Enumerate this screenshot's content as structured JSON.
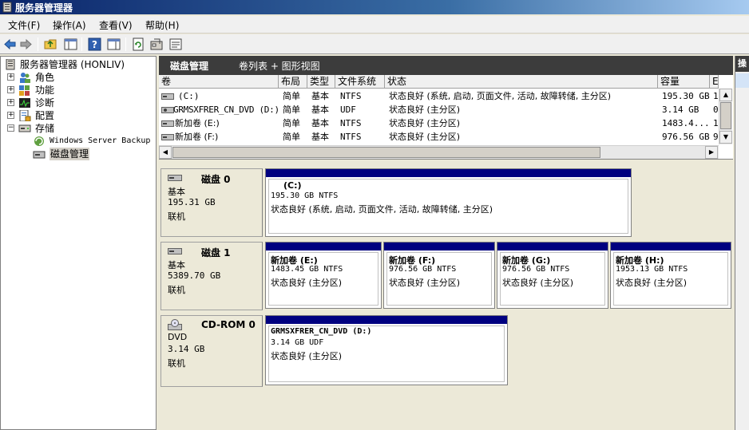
{
  "window": {
    "title": "服务器管理器"
  },
  "menu": [
    "文件(F)",
    "操作(A)",
    "查看(V)",
    "帮助(H)"
  ],
  "toolbar": {
    "icons": [
      "back-arrow-icon",
      "forward-arrow-icon",
      "up-folder-icon",
      "show-hide-tree-icon",
      "help-icon",
      "show-hide-action-icon",
      "refresh-icon",
      "properties-icon",
      "export-icon"
    ]
  },
  "tree": {
    "root": "服务器管理器 (HONLIV)",
    "items": [
      {
        "label": "角色",
        "expander": "+"
      },
      {
        "label": "功能",
        "expander": "+"
      },
      {
        "label": "诊断",
        "expander": "+"
      },
      {
        "label": "配置",
        "expander": "+"
      },
      {
        "label": "存储",
        "expander": "−"
      }
    ],
    "storage_children": [
      "Windows Server Backup",
      "磁盘管理"
    ]
  },
  "panel": {
    "title": "磁盘管理",
    "subtitle": "卷列表 + 图形视图"
  },
  "volume_list": {
    "columns": [
      "卷",
      "布局",
      "类型",
      "文件系统",
      "状态",
      "容量",
      "E"
    ],
    "rows": [
      {
        "volume": "(C:)",
        "layout": "简单",
        "type": "基本",
        "fs": "NTFS",
        "status": "状态良好 (系统, 启动, 页面文件, 活动, 故障转储, 主分区)",
        "capacity": "195.30 GB",
        "extra": "1"
      },
      {
        "volume": "GRMSXFRER_CN_DVD (D:)",
        "layout": "简单",
        "type": "基本",
        "fs": "UDF",
        "status": "状态良好 (主分区)",
        "capacity": "3.14 GB",
        "extra": "0"
      },
      {
        "volume": "新加卷 (E:)",
        "layout": "简单",
        "type": "基本",
        "fs": "NTFS",
        "status": "状态良好 (主分区)",
        "capacity": "1483.4...",
        "extra": "1"
      },
      {
        "volume": "新加卷 (F:)",
        "layout": "简单",
        "type": "基本",
        "fs": "NTFS",
        "status": "状态良好 (主分区)",
        "capacity": "976.56 GB",
        "extra": "9"
      }
    ]
  },
  "disks": [
    {
      "name": "磁盘 0",
      "kind": "基本",
      "size": "195.31 GB",
      "state": "联机",
      "partitions": [
        {
          "name": "(C:)",
          "size": "195.30 GB NTFS",
          "status": "状态良好 (系统, 启动, 页面文件, 活动, 故障转储, 主分区)"
        }
      ]
    },
    {
      "name": "磁盘 1",
      "kind": "基本",
      "size": "5389.70 GB",
      "state": "联机",
      "partitions": [
        {
          "name": "新加卷  (E:)",
          "size": "1483.45 GB NTFS",
          "status": "状态良好 (主分区)"
        },
        {
          "name": "新加卷  (F:)",
          "size": "976.56 GB NTFS",
          "status": "状态良好 (主分区)"
        },
        {
          "name": "新加卷  (G:)",
          "size": "976.56 GB NTFS",
          "status": "状态良好 (主分区)"
        },
        {
          "name": "新加卷  (H:)",
          "size": "1953.13 GB NTFS",
          "status": "状态良好 (主分区)"
        }
      ]
    },
    {
      "name": "CD-ROM 0",
      "kind": "DVD",
      "size": "3.14 GB",
      "state": "联机",
      "partitions": [
        {
          "name": "GRMSXFRER_CN_DVD  (D:)",
          "size": "3.14 GB UDF",
          "status": "状态良好 (主分区)"
        }
      ]
    }
  ],
  "actions_pane": {
    "label": "操"
  },
  "colors": {
    "partition_bar": "#000080",
    "title_gradient_start": "#0a246a",
    "panel_header": "#3c3c3c"
  }
}
